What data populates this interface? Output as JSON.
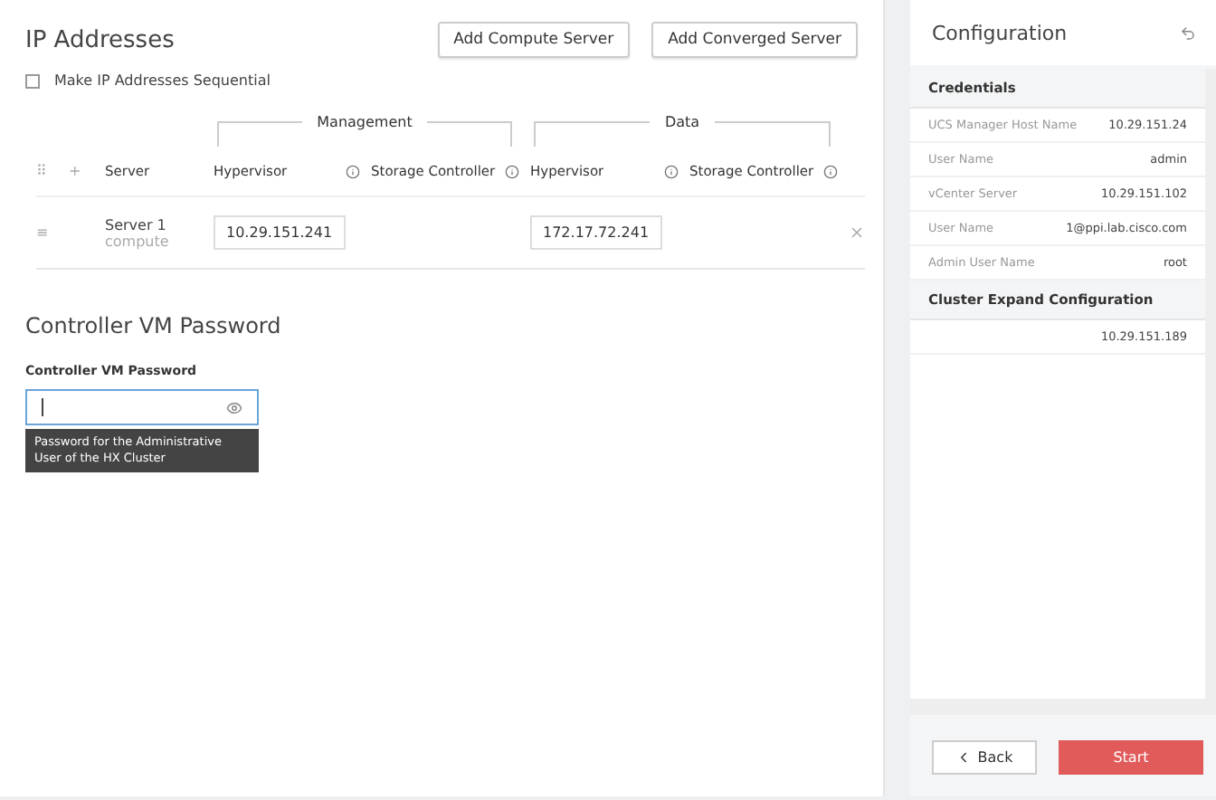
{
  "main": {
    "title": "IP Addresses",
    "buttons": [
      "Add Compute Server",
      "Add Converged Server"
    ],
    "sequential": {
      "label": "Make IP Addresses Sequential",
      "checked": false
    },
    "table": {
      "drag_header": "⠿",
      "sort_header": "+",
      "groups": [
        "Management",
        "Data"
      ],
      "columns": [
        {
          "label": "Server",
          "info": false
        },
        {
          "label": "Hypervisor",
          "info": true
        },
        {
          "label": "Storage Controller",
          "info": true
        },
        {
          "label": "Hypervisor",
          "info": true
        },
        {
          "label": "Storage Controller",
          "info": true
        }
      ],
      "rows": [
        {
          "drag": "≡",
          "server": "Server 1",
          "type": "compute",
          "mgmt_hypervisor": "10.29.151.241",
          "data_hypervisor": "172.17.72.241"
        }
      ]
    },
    "password_section": {
      "title": "Controller VM Password",
      "label": "Controller VM Password",
      "tooltip": "Password for the Administrative User of the HX Cluster"
    }
  },
  "sidebar": {
    "title": "Configuration",
    "sections": [
      {
        "title": "Credentials",
        "items": [
          {
            "label": "UCS Manager Host Name",
            "value": "10.29.151.24"
          },
          {
            "label": "User Name",
            "value": "admin"
          },
          {
            "label": "vCenter Server",
            "value": "10.29.151.102"
          },
          {
            "label": "User Name",
            "value": "1@ppi.lab.cisco.com"
          },
          {
            "label": "Admin User Name",
            "value": "root"
          }
        ]
      },
      {
        "title": "Cluster Expand Configuration",
        "items": [
          {
            "value": "10.29.151.189"
          }
        ]
      }
    ],
    "back": "Back",
    "start": "Start"
  }
}
